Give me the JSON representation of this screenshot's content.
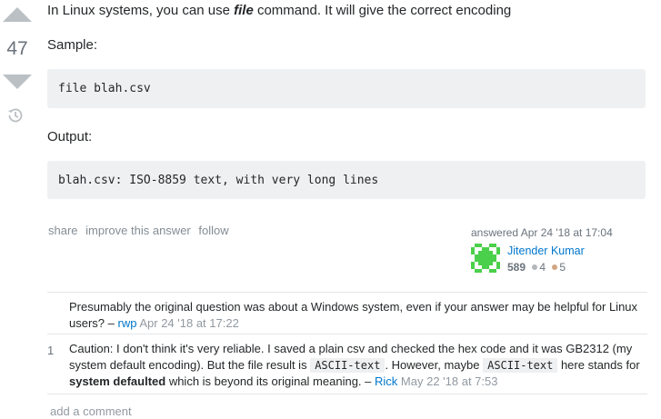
{
  "vote": {
    "count": "47"
  },
  "answer": {
    "intro_prefix": "In Linux systems, you can use ",
    "intro_emph": "file",
    "intro_suffix": " command. It will give the correct encoding",
    "sample_label": "Sample:",
    "sample_code": "file blah.csv",
    "output_label": "Output:",
    "output_code": "blah.csv: ISO-8859 text, with very long lines"
  },
  "post_menu": {
    "share": "share",
    "improve": "improve this answer",
    "follow": "follow"
  },
  "signature": {
    "action": "answered Apr 24 '18 at 17:04",
    "user_name": "Jitender Kumar",
    "reputation": "589",
    "silver_badges": "4",
    "bronze_badges": "5",
    "silver_color": "#b4b8bc",
    "bronze_color": "#d1a684"
  },
  "comments": [
    {
      "score": "",
      "text": "Presumably the original question was about a Windows system, even if your answer may be helpful for Linux users? –",
      "user": "rwp",
      "date": "Apr 24 '18 at 17:22"
    },
    {
      "score": "1",
      "text_1": "Caution: I don't think it's very reliable. I saved a plain csv and checked the hex code and it was GB2312 (my system default encoding). But the file result is ",
      "code_1": "ASCII-text",
      "text_2": ". However, maybe ",
      "code_2": "ASCII-text",
      "text_3": " here stands for ",
      "bold": "system defaulted",
      "text_4": " which is beyond its original meaning. –",
      "user": "Rick",
      "date": "May 22 '18 at 7:53"
    }
  ],
  "add_comment": "add a comment",
  "colors": {
    "link": "#0077cc",
    "muted": "#6a737c",
    "arrow": "#bbc0c4",
    "code_bg": "#eff0f1",
    "avatar": "#4ad04a"
  }
}
